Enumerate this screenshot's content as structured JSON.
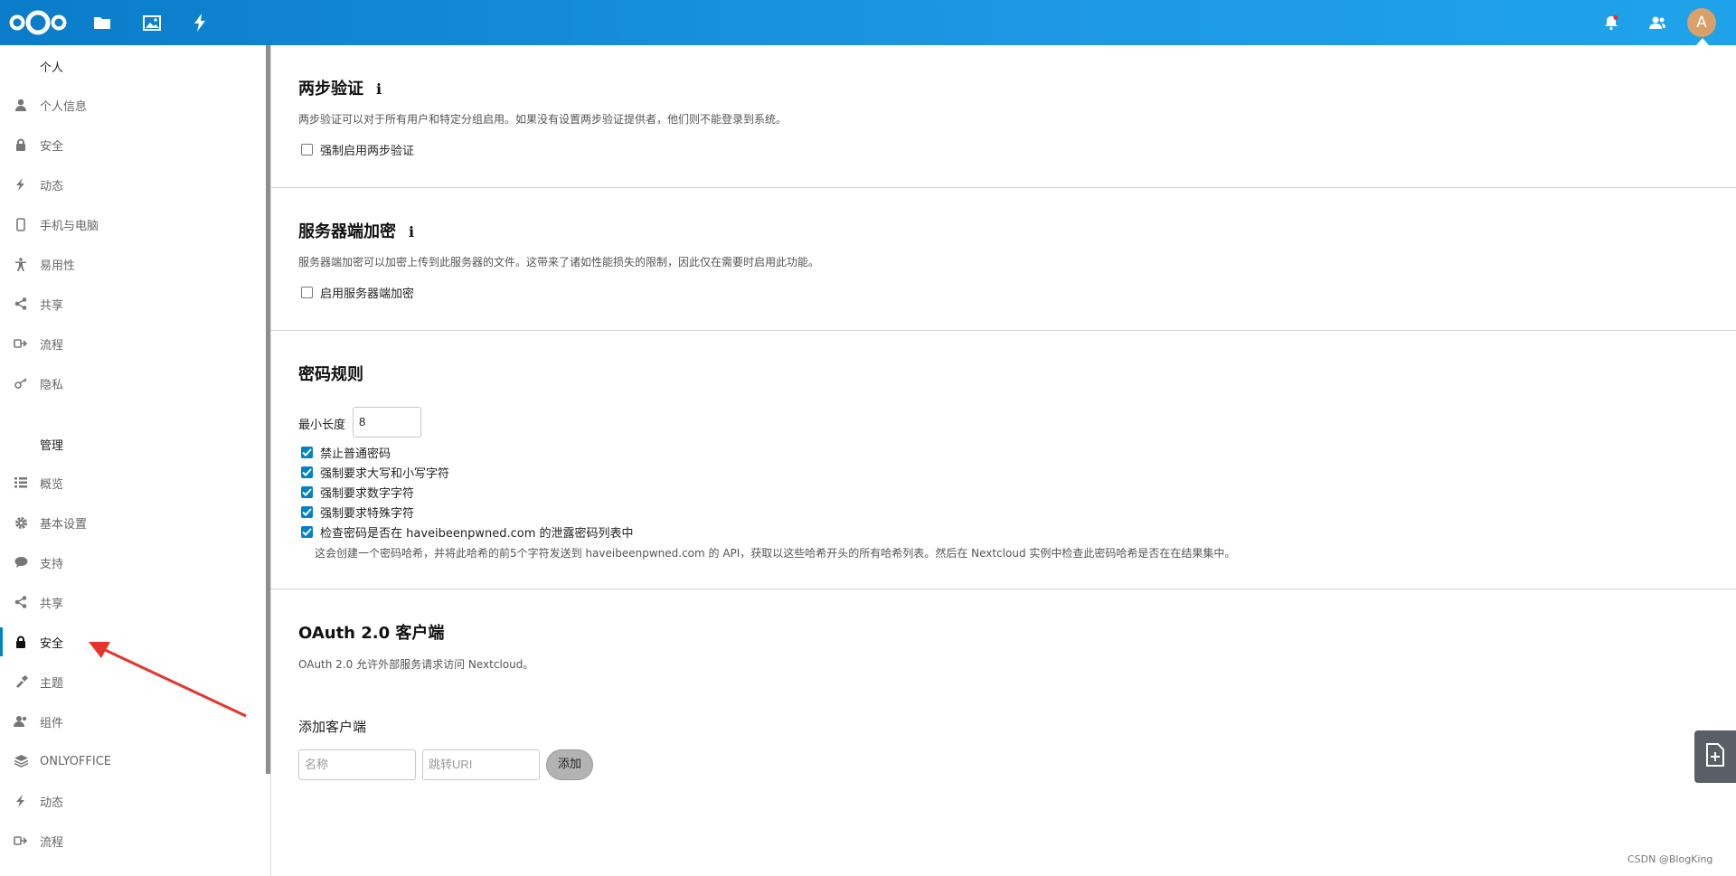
{
  "header": {
    "logo_icon": "nextcloud-logo-icon",
    "nav": [
      "folder-icon",
      "image-icon",
      "lightning-icon"
    ],
    "notifications_icon": "bell-icon",
    "contacts_icon": "contacts-icon",
    "avatar_letter": "A",
    "avatar_color": "#d9a06a"
  },
  "sidebar": {
    "personal_heading": "个人",
    "personal_items": [
      {
        "label": "个人信息",
        "icon": "user-icon"
      },
      {
        "label": "安全",
        "icon": "lock-icon"
      },
      {
        "label": "动态",
        "icon": "lightning-icon"
      },
      {
        "label": "手机与电脑",
        "icon": "phone-icon"
      },
      {
        "label": "易用性",
        "icon": "accessibility-icon"
      },
      {
        "label": "共享",
        "icon": "share-icon"
      },
      {
        "label": "流程",
        "icon": "flow-icon"
      },
      {
        "label": "隐私",
        "icon": "key-icon"
      }
    ],
    "admin_heading": "管理",
    "admin_items": [
      {
        "label": "概览",
        "icon": "list-icon"
      },
      {
        "label": "基本设置",
        "icon": "gear-icon"
      },
      {
        "label": "支持",
        "icon": "speech-bubble-icon"
      },
      {
        "label": "共享",
        "icon": "share-icon"
      },
      {
        "label": "安全",
        "icon": "lock-icon",
        "active": true
      },
      {
        "label": "主题",
        "icon": "paint-icon"
      },
      {
        "label": "组件",
        "icon": "users-icon"
      },
      {
        "label": "ONLYOFFICE",
        "icon": "layers-icon"
      },
      {
        "label": "动态",
        "icon": "lightning-icon"
      },
      {
        "label": "流程",
        "icon": "flow-icon"
      }
    ]
  },
  "two_factor": {
    "title": "两步验证",
    "info": "i",
    "description": "两步验证可以对于所有用户和特定分组启用。如果没有设置两步验证提供者，他们则不能登录到系统。",
    "enforce_label": "强制启用两步验证",
    "enforce_checked": false
  },
  "server_encryption": {
    "title": "服务器端加密",
    "info": "i",
    "description": "服务器端加密可以加密上传到此服务器的文件。这带来了诸如性能损失的限制，因此仅在需要时启用此功能。",
    "enable_label": "启用服务器端加密",
    "enable_checked": false
  },
  "password_policy": {
    "title": "密码规则",
    "min_length_label": "最小长度",
    "min_length_value": "8",
    "options": [
      {
        "label": "禁止普通密码",
        "checked": true
      },
      {
        "label": "强制要求大写和小写字符",
        "checked": true
      },
      {
        "label": "强制要求数字字符",
        "checked": true
      },
      {
        "label": "强制要求特殊字符",
        "checked": true
      },
      {
        "label": "检查密码是否在 haveibeenpwned.com 的泄露密码列表中",
        "checked": true
      }
    ],
    "hibp_note": "这会创建一个密码哈希，并将此哈希的前5个字符发送到 haveibeenpwned.com 的 API，获取以这些哈希开头的所有哈希列表。然后在 Nextcloud 实例中检查此密码哈希是否在在结果集中。"
  },
  "oauth": {
    "title": "OAuth 2.0 客户端",
    "description": "OAuth 2.0 允许外部服务请求访问 Nextcloud。",
    "add_client_heading": "添加客户端",
    "name_placeholder": "名称",
    "redirect_placeholder": "跳转URI",
    "add_button": "添加"
  },
  "side_tab_icon": "new-file-icon",
  "watermark": "CSDN @BlogKing"
}
